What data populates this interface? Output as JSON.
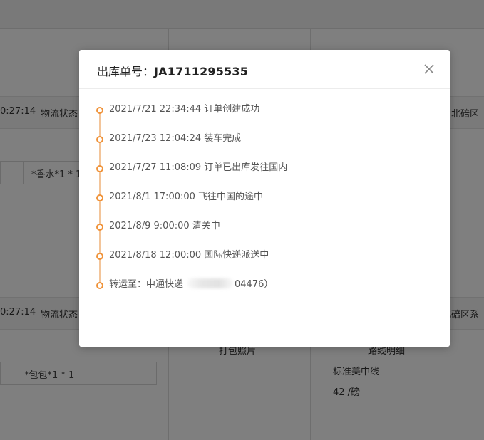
{
  "background": {
    "rows": [
      {
        "time_fragment": "0:27:14",
        "status_label": "物流状态",
        "address_fragment": "区北碚区",
        "item": "*香水*1 * 1"
      },
      {
        "time_fragment": "0:27:14",
        "status_label": "物流状态",
        "address_fragment": "北碚区系",
        "item": "*包包*1 * 1",
        "photo_label": "打包照片",
        "route_label": "路线明细",
        "route_name": "标准美中线",
        "price": "42 /磅"
      }
    ]
  },
  "modal": {
    "title_label": "出库单号：",
    "title_number": "JA1711295535",
    "close_icon": "close-icon",
    "timeline": [
      {
        "text": "2021/7/21 22:34:44 订单创建成功"
      },
      {
        "text": "2021/7/23 12:04:24 装车完成"
      },
      {
        "text": "2021/7/27 11:08:09 订单已出库发往国内"
      },
      {
        "text": "2021/8/1 17:00:00 飞往中国的途中"
      },
      {
        "text": "2021/8/9 9:00:00 清关中"
      },
      {
        "text": "2021/8/18 12:00:00 国际快递派送中"
      }
    ],
    "last_entry": {
      "prefix": "转运至：中通快递",
      "suffix": "04476）"
    }
  },
  "colors": {
    "accent": "#f0933a",
    "overlay": "rgba(0,0,0,0.5)"
  }
}
